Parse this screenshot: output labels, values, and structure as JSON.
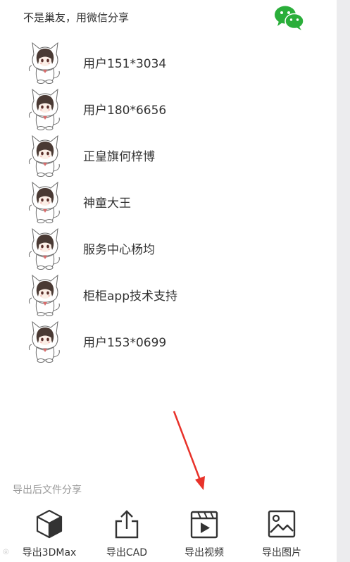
{
  "header": {
    "share_text": "不是巢友，用微信分享",
    "wechat_icon": "wechat-icon",
    "wechat_color": "#2aae3a"
  },
  "users": [
    {
      "name": "用户151*3034",
      "avatar": "anime-avatar"
    },
    {
      "name": "用户180*6656",
      "avatar": "anime-avatar"
    },
    {
      "name": "正皇旗何梓博",
      "avatar": "anime-avatar"
    },
    {
      "name": "神童大王",
      "avatar": "anime-avatar"
    },
    {
      "name": "服务中心杨均",
      "avatar": "anime-avatar"
    },
    {
      "name": "柜柜app技术支持",
      "avatar": "anime-avatar"
    },
    {
      "name": "用户153*0699",
      "avatar": "anime-avatar"
    }
  ],
  "export": {
    "section_label": "导出后文件分享",
    "buttons": [
      {
        "label": "导出3DMax",
        "icon": "cube-icon"
      },
      {
        "label": "导出CAD",
        "icon": "share-upload-icon"
      },
      {
        "label": "导出视频",
        "icon": "video-play-icon"
      },
      {
        "label": "导出图片",
        "icon": "image-icon"
      }
    ]
  },
  "annotation": {
    "arrow_color": "#e8322a"
  }
}
